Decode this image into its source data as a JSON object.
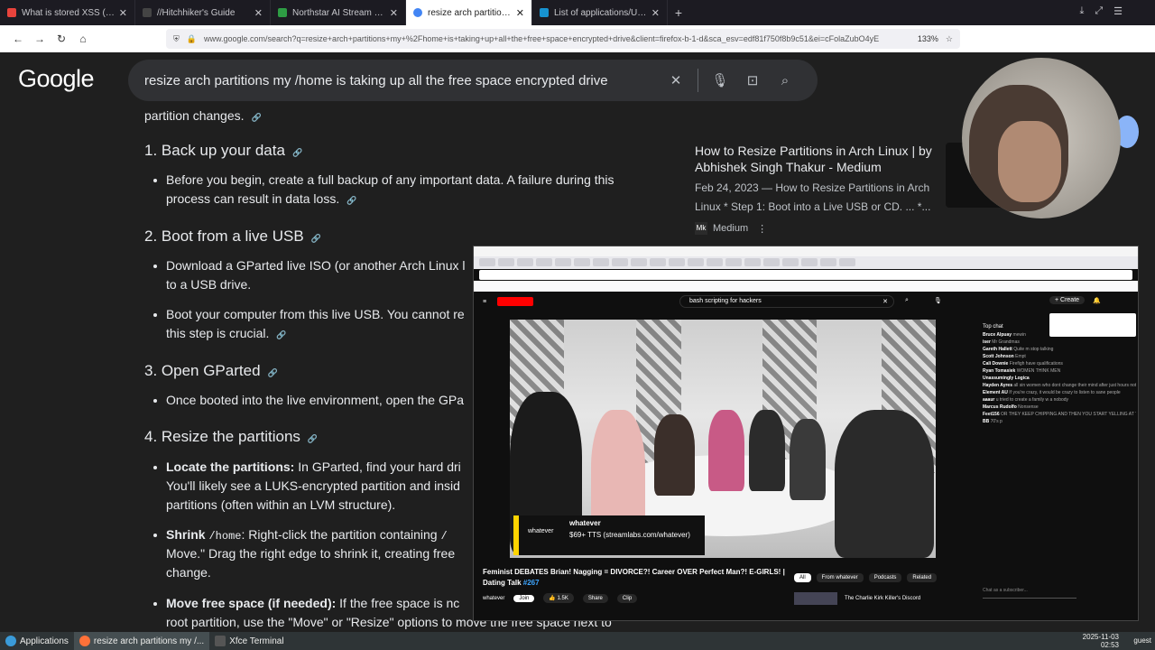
{
  "browser": {
    "tabs": [
      {
        "title": "What is stored XSS (cross-s",
        "color": "#e8433c",
        "active": false
      },
      {
        "title": "//Hitchhiker's Guide",
        "color": "#333333",
        "active": false
      },
      {
        "title": "Northstar AI Stream - Watch",
        "color": "#2e9c44",
        "active": false
      },
      {
        "title": "resize arch partitions my /ho",
        "color": "#4285f4",
        "active": true
      },
      {
        "title": "List of applications/Utilities",
        "color": "#1793d1",
        "active": false
      }
    ],
    "new_tab": "+",
    "url": "www.google.com/search?q=resize+arch+partitions+my+%2Fhome+is+taking+up+all+the+free+space+encrypted+drive&client=firefox-b-1-d&sca_esv=edf81f750f8b9c51&ei=cFolaZubO4yE",
    "zoom": "133%"
  },
  "google": {
    "logo": "Google",
    "query": "resize arch partitions my /home is taking up all the free space encrypted drive",
    "answer": {
      "intro_tail": "partition changes.",
      "h1": "1. Back up your data",
      "b1a": "Before you begin, create a full backup of any important data. A failure during this",
      "b1b": "process can result in data loss.",
      "h2": "2. Boot from a live USB",
      "b2a": "Download a GParted live ISO (or another Arch Linux l",
      "b2b": "to a USB drive.",
      "b3a": "Boot your computer from this live USB. You cannot re",
      "b3b": "this step is crucial.",
      "h3": "3. Open GParted",
      "b4a": "Once booted into the live environment, open the GPa",
      "h4": "4. Resize the partitions",
      "b5_bold": "Locate the partitions:",
      "b5a": " In GParted, find your hard dri",
      "b5b": "You'll likely see a LUKS-encrypted partition and insid",
      "b5c": "partitions (often within an LVM structure).",
      "b6_bold": "Shrink ",
      "b6_code": "/home",
      "b6a": ": Right-click the partition containing ",
      "b6a2": "/",
      "b6b": "Move.\" Drag the right edge to shrink it, creating free",
      "b6c": "change.",
      "b7_bold": "Move free space (if needed):",
      "b7a": " If the free space is nc",
      "b7b": "root partition, use the \"Move\" or \"Resize\" options to move the free space next to"
    },
    "source": {
      "title": "How to Resize Partitions in Arch Linux | by Abhishek Singh Thakur - Medium",
      "snippet": "Feb 24, 2023 — How to Resize Partitions in Arch Linux * Step 1: Boot into a Live USB or CD. ... *...",
      "site": "Medium",
      "site_icon": "Mk"
    }
  },
  "video_window": {
    "search": "bash scripting for hackers",
    "create": "+ Create",
    "banner_name": "whatever",
    "banner_tts": "$69+ TTS (streamlabs.com/whatever)",
    "banner_logo": "whatever",
    "title": "Feminist DEBATES Brian! Nagging = DIVORCE?! Career OVER Perfect Man?! E-GIRLS! | Dating Talk",
    "tag": "#267",
    "channel": "whatever",
    "join": "Join",
    "likes": "1.5K",
    "share": "Share",
    "clip": "Clip",
    "filters": [
      "All",
      "From whatever",
      "Podcasts",
      "Related"
    ],
    "rec_title": "The Charlie Kirk Killer's Discord",
    "chat_header": "Top chat",
    "chat_input": "Chat as a subscriber...",
    "chat": [
      {
        "user": "Bruce Alpuay",
        "text": "mewin"
      },
      {
        "user": "iser",
        "text": "Mr Grandmas"
      },
      {
        "user": "Gareth Hallett",
        "text": "Quite m stop talking"
      },
      {
        "user": "Scott Johnson",
        "text": "Empt"
      },
      {
        "user": "Cali Downie",
        "text": "Firefigh have qualifications"
      },
      {
        "user": "Ryan Tomasiek",
        "text": "WOMEN THINK MEN"
      },
      {
        "user": "Unassumingly Logica",
        "text": ""
      },
      {
        "user": "Hayden Ayres",
        "text": "all sin women who dont change their mind after just hours not even days/weeks smh"
      },
      {
        "user": "Element AU",
        "text": "If you're crazy, it would be crazy to listen to sane people"
      },
      {
        "user": "aaaur",
        "text": "u tried to create a family w a nobody"
      },
      {
        "user": "Marcus Rudolfo",
        "text": "Nonsense"
      },
      {
        "user": "Feet156",
        "text": "OR THEY KEEP CHIPPING AND THEN YOU START YELLING AT THEM"
      },
      {
        "user": "BB",
        "text": "70's p"
      }
    ]
  },
  "taskbar": {
    "applications": "Applications",
    "window1": "resize arch partitions my /...",
    "window2": "Xfce Terminal",
    "time": "Monday 3 November 02:53",
    "date": "2025-11-03",
    "time2": "02:53",
    "user": "guest"
  }
}
